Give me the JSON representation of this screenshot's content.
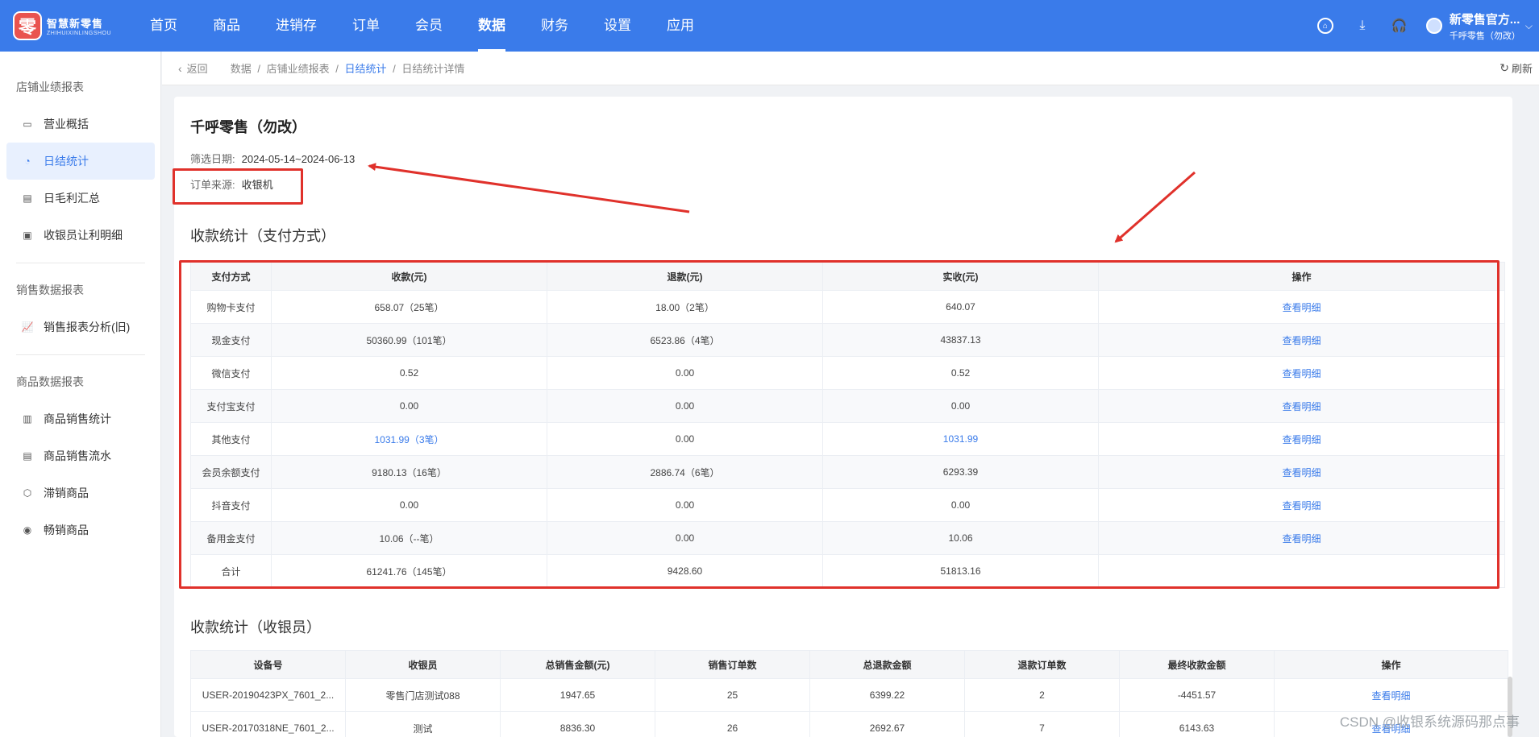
{
  "brand": {
    "mark": "零",
    "name": "智慧新零售",
    "sub": "ZHIHUIXINLINGSHOU"
  },
  "nav": [
    "首页",
    "商品",
    "进销存",
    "订单",
    "会员",
    "数据",
    "财务",
    "设置",
    "应用"
  ],
  "nav_active": "数据",
  "user": {
    "name": "新零售官方...",
    "store": "千呼零售（勿改）"
  },
  "icons": {
    "home": "home-icon",
    "download": "download-icon",
    "support": "headset-icon"
  },
  "sidebar": {
    "groups": [
      "店铺业绩报表",
      "销售数据报表",
      "商品数据报表"
    ],
    "items": [
      "营业概括",
      "日结统计",
      "日毛利汇总",
      "收银员让利明细",
      "销售报表分析(旧)",
      "商品销售统计",
      "商品销售流水",
      "滞销商品",
      "畅销商品"
    ],
    "active": "日结统计"
  },
  "breadcrumb": {
    "back": "返回",
    "c1": "数据",
    "c2": "店铺业绩报表",
    "c3": "日结统计",
    "c4": "日结统计详情",
    "sep": "/"
  },
  "refresh": "刷新",
  "store_title": "千呼零售（勿改）",
  "filter": {
    "date_label": "筛选日期:",
    "date_value": "2024-05-14~2024-06-13",
    "source_label": "订单来源:",
    "source_value": "收银机"
  },
  "payment": {
    "title": "收款统计（支付方式）",
    "headers": [
      "支付方式",
      "收款(元)",
      "退款(元)",
      "实收(元)",
      "操作"
    ],
    "rows": [
      [
        "购物卡支付",
        "658.07（25笔）",
        "18.00（2笔）",
        "640.07",
        "查看明细"
      ],
      [
        "现金支付",
        "50360.99（101笔）",
        "6523.86（4笔）",
        "43837.13",
        "查看明细"
      ],
      [
        "微信支付",
        "0.52",
        "0.00",
        "0.52",
        "查看明细"
      ],
      [
        "支付宝支付",
        "0.00",
        "0.00",
        "0.00",
        "查看明细"
      ],
      [
        "其他支付",
        "1031.99（3笔）",
        "0.00",
        "1031.99",
        "查看明细"
      ],
      [
        "会员余额支付",
        "9180.13（16笔）",
        "2886.74（6笔）",
        "6293.39",
        "查看明细"
      ],
      [
        "抖音支付",
        "0.00",
        "0.00",
        "0.00",
        "查看明细"
      ],
      [
        "备用金支付",
        "10.06（--笔）",
        "0.00",
        "10.06",
        "查看明细"
      ],
      [
        "合计",
        "61241.76（145笔）",
        "9428.60",
        "51813.16",
        ""
      ]
    ]
  },
  "cashier": {
    "title": "收款统计（收银员）",
    "headers": [
      "设备号",
      "收银员",
      "总销售金额(元)",
      "销售订单数",
      "总退款金额",
      "退款订单数",
      "最终收款金额",
      "操作"
    ],
    "rows": [
      [
        "USER-20190423PX_7601_2...",
        "零售门店测试088",
        "1947.65",
        "25",
        "6399.22",
        "2",
        "-4451.57",
        "查看明细"
      ],
      [
        "USER-20170318NE_7601_2...",
        "测试",
        "8836.30",
        "26",
        "2692.67",
        "7",
        "6143.63",
        "查看明细"
      ]
    ]
  },
  "annotation_color": "#e0312b",
  "accent": "#3a7bea",
  "watermark": "CSDN @收银系统源码那点事"
}
